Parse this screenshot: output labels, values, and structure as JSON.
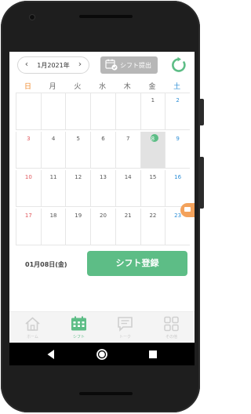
{
  "header": {
    "month_label": "1月2021年",
    "prev_label": "‹",
    "next_label": "›",
    "submit_label": "シフト提出"
  },
  "calendar": {
    "weekdays": [
      "日",
      "月",
      "火",
      "水",
      "木",
      "金",
      "土"
    ],
    "weeks": [
      [
        "",
        "",
        "",
        "",
        "",
        "1",
        "2"
      ],
      [
        "3",
        "4",
        "5",
        "6",
        "7",
        "8",
        "9"
      ],
      [
        "10",
        "11",
        "12",
        "13",
        "14",
        "15",
        "16"
      ],
      [
        "17",
        "18",
        "19",
        "20",
        "21",
        "22",
        "23"
      ]
    ],
    "selected_day": "8"
  },
  "action": {
    "selected_date": "01月08日(金)",
    "register_label": "シフト登録"
  },
  "tabs": [
    {
      "label": "ホーム",
      "icon": "home-icon",
      "active": false
    },
    {
      "label": "シフト",
      "icon": "calendar-icon",
      "active": true
    },
    {
      "label": "トーク",
      "icon": "chat-icon",
      "active": false
    },
    {
      "label": "その他",
      "icon": "grid-icon",
      "active": false
    }
  ],
  "colors": {
    "accent": "#5dbd86",
    "sunday": "#e0565b",
    "saturday": "#2f8fd6",
    "badge": "#f3a25c"
  }
}
